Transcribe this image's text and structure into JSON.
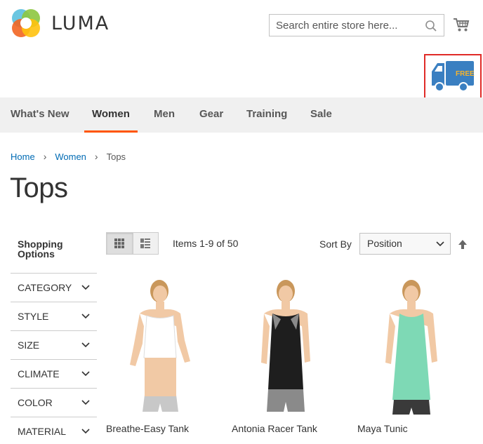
{
  "header": {
    "logo_text": "LUMA",
    "search_placeholder": "Search entire store here...",
    "free_badge": "FREE"
  },
  "nav": {
    "items": [
      {
        "label": "What's New"
      },
      {
        "label": "Women",
        "active": true
      },
      {
        "label": "Men"
      },
      {
        "label": "Gear"
      },
      {
        "label": "Training"
      },
      {
        "label": "Sale"
      }
    ]
  },
  "breadcrumb": [
    "Home",
    "Women",
    "Tops"
  ],
  "page_title": "Tops",
  "sidebar": {
    "title": "Shopping Options",
    "filters": [
      "CATEGORY",
      "STYLE",
      "SIZE",
      "CLIMATE",
      "COLOR",
      "MATERIAL"
    ]
  },
  "toolbar": {
    "amount": "Items 1-9 of 50",
    "sort_label": "Sort By",
    "sort_value": "Position"
  },
  "products": [
    {
      "name": "Breathe-Easy Tank",
      "top_color": "#ffffff",
      "shorts_color": "#c8c8c8"
    },
    {
      "name": "Antonia Racer Tank",
      "top_color": "#1e1e1e",
      "shorts_color": "#8a8a8a"
    },
    {
      "name": "Maya Tunic",
      "top_color": "#7ed9b5",
      "shorts_color": "#3a3a3a"
    }
  ],
  "colors": {
    "accent": "#ff5501",
    "link": "#006bb4",
    "highlight_border": "#e02b27",
    "truck": "#3a7fc1"
  }
}
